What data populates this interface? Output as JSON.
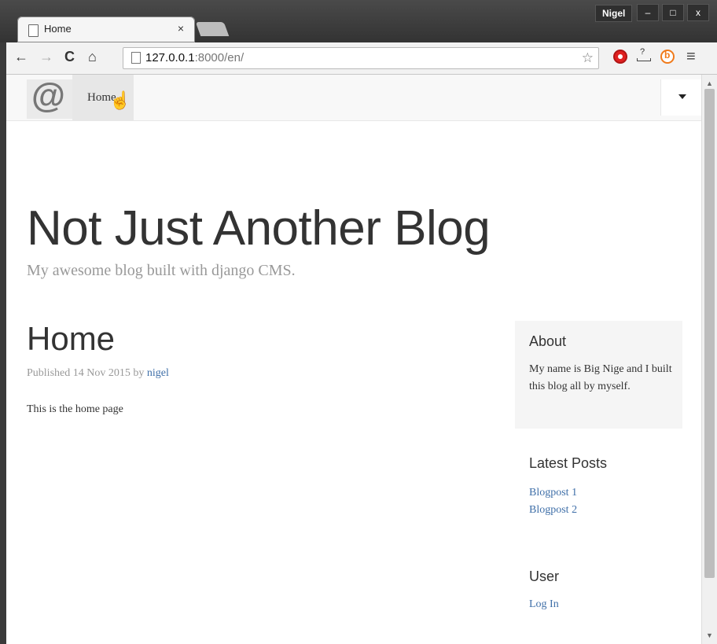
{
  "browser": {
    "tab_title": "Home",
    "tab_close": "×",
    "profile_name": "Nigel",
    "window_buttons": {
      "minimize": "–",
      "maximize": "□",
      "close": "x"
    },
    "url_host": "127.0.0.1",
    "url_rest": ":8000/en/",
    "nav": {
      "back": "←",
      "forward": "→",
      "reload": "C",
      "home": "⌂"
    },
    "star": "☆",
    "menu": "≡"
  },
  "site": {
    "brand_symbol": "@",
    "nav_item": "Home",
    "title": "Not Just Another Blog",
    "tagline": "My awesome blog built with django CMS."
  },
  "post": {
    "title": "Home",
    "meta_prefix": "Published 14 Nov 2015 by ",
    "author": "nigel",
    "body": "This is the home page"
  },
  "sidebar": {
    "about_title": "About",
    "about_text": "My name is Big Nige and I built this blog all by myself.",
    "latest_title": "Latest Posts",
    "latest_posts": [
      "Blogpost 1",
      "Blogpost 2"
    ],
    "user_title": "User",
    "login_label": "Log In"
  }
}
